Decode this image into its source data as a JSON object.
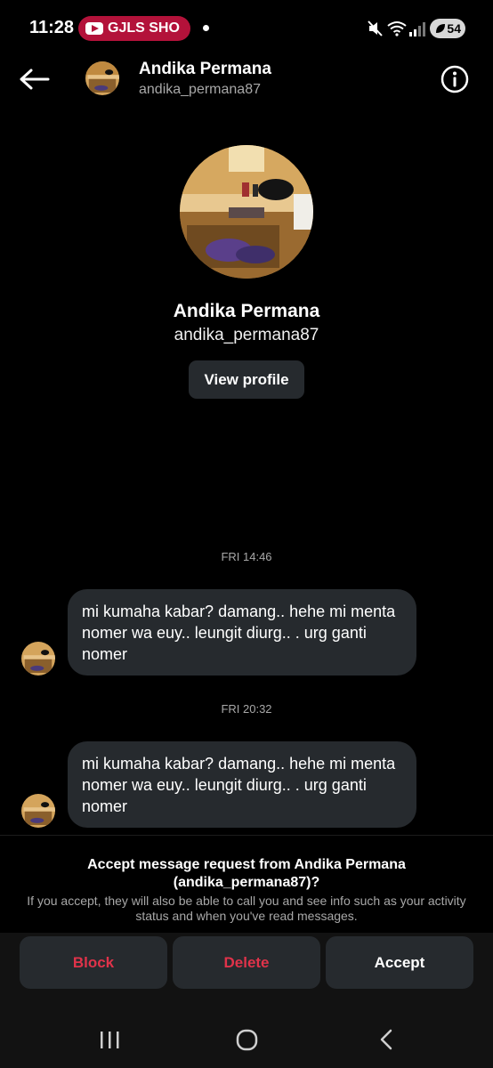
{
  "status_bar": {
    "time": "11:28",
    "notification_pill": "GJLS SHO",
    "battery": "54"
  },
  "header": {
    "name": "Andika Permana",
    "username": "andika_permana87"
  },
  "profile": {
    "name": "Andika Permana",
    "username": "andika_permana87",
    "view_profile_label": "View profile"
  },
  "messages": [
    {
      "timestamp": "FRI 14:46",
      "text": "mi kumaha kabar? damang.. hehe mi menta nomer wa euy.. leungit diurg.. . urg ganti nomer"
    },
    {
      "timestamp": "FRI 20:32",
      "text": "mi kumaha kabar? damang.. hehe mi menta nomer wa euy.. leungit diurg.. . urg ganti nomer"
    }
  ],
  "request": {
    "title": "Accept message request from Andika Permana (andika_permana87)?",
    "description": "If you accept, they will also be able to call you and see info such as your activity status and when you've read messages.",
    "block_label": "Block",
    "delete_label": "Delete",
    "accept_label": "Accept"
  },
  "colors": {
    "background": "#000000",
    "bubble": "#262a2e",
    "destructive": "#e0334a",
    "secondary_text": "#a8a8a8"
  }
}
